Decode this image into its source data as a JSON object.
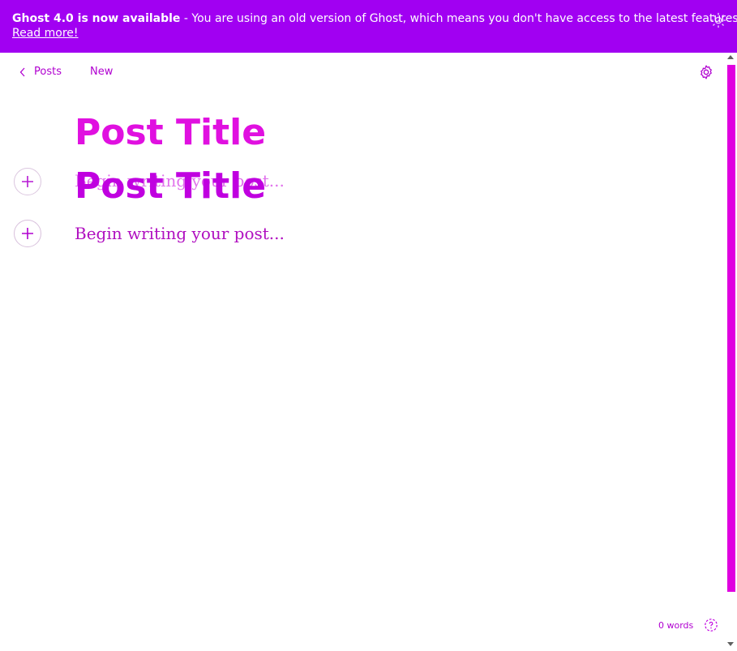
{
  "banner": {
    "headline": "Ghost 4.0 is now available",
    "message": " - You are using an old version of Ghost, which means you don't have access to the latest features.",
    "link_label": "Read more!",
    "background_color": "#a100f2",
    "icon": "gear-icon"
  },
  "header": {
    "back_label": "Posts",
    "status": "New",
    "settings_icon": "gear-icon"
  },
  "editor": {
    "title_placeholder": "Post Title",
    "body_placeholder": "Begin writing your post...",
    "add_card_icon": "plus-icon"
  },
  "footer": {
    "word_count": "0 words",
    "help_icon": "help-icon"
  },
  "colors": {
    "accent": "#c000e0",
    "title": "#e010e0",
    "scrollbar": "#e000e0"
  }
}
